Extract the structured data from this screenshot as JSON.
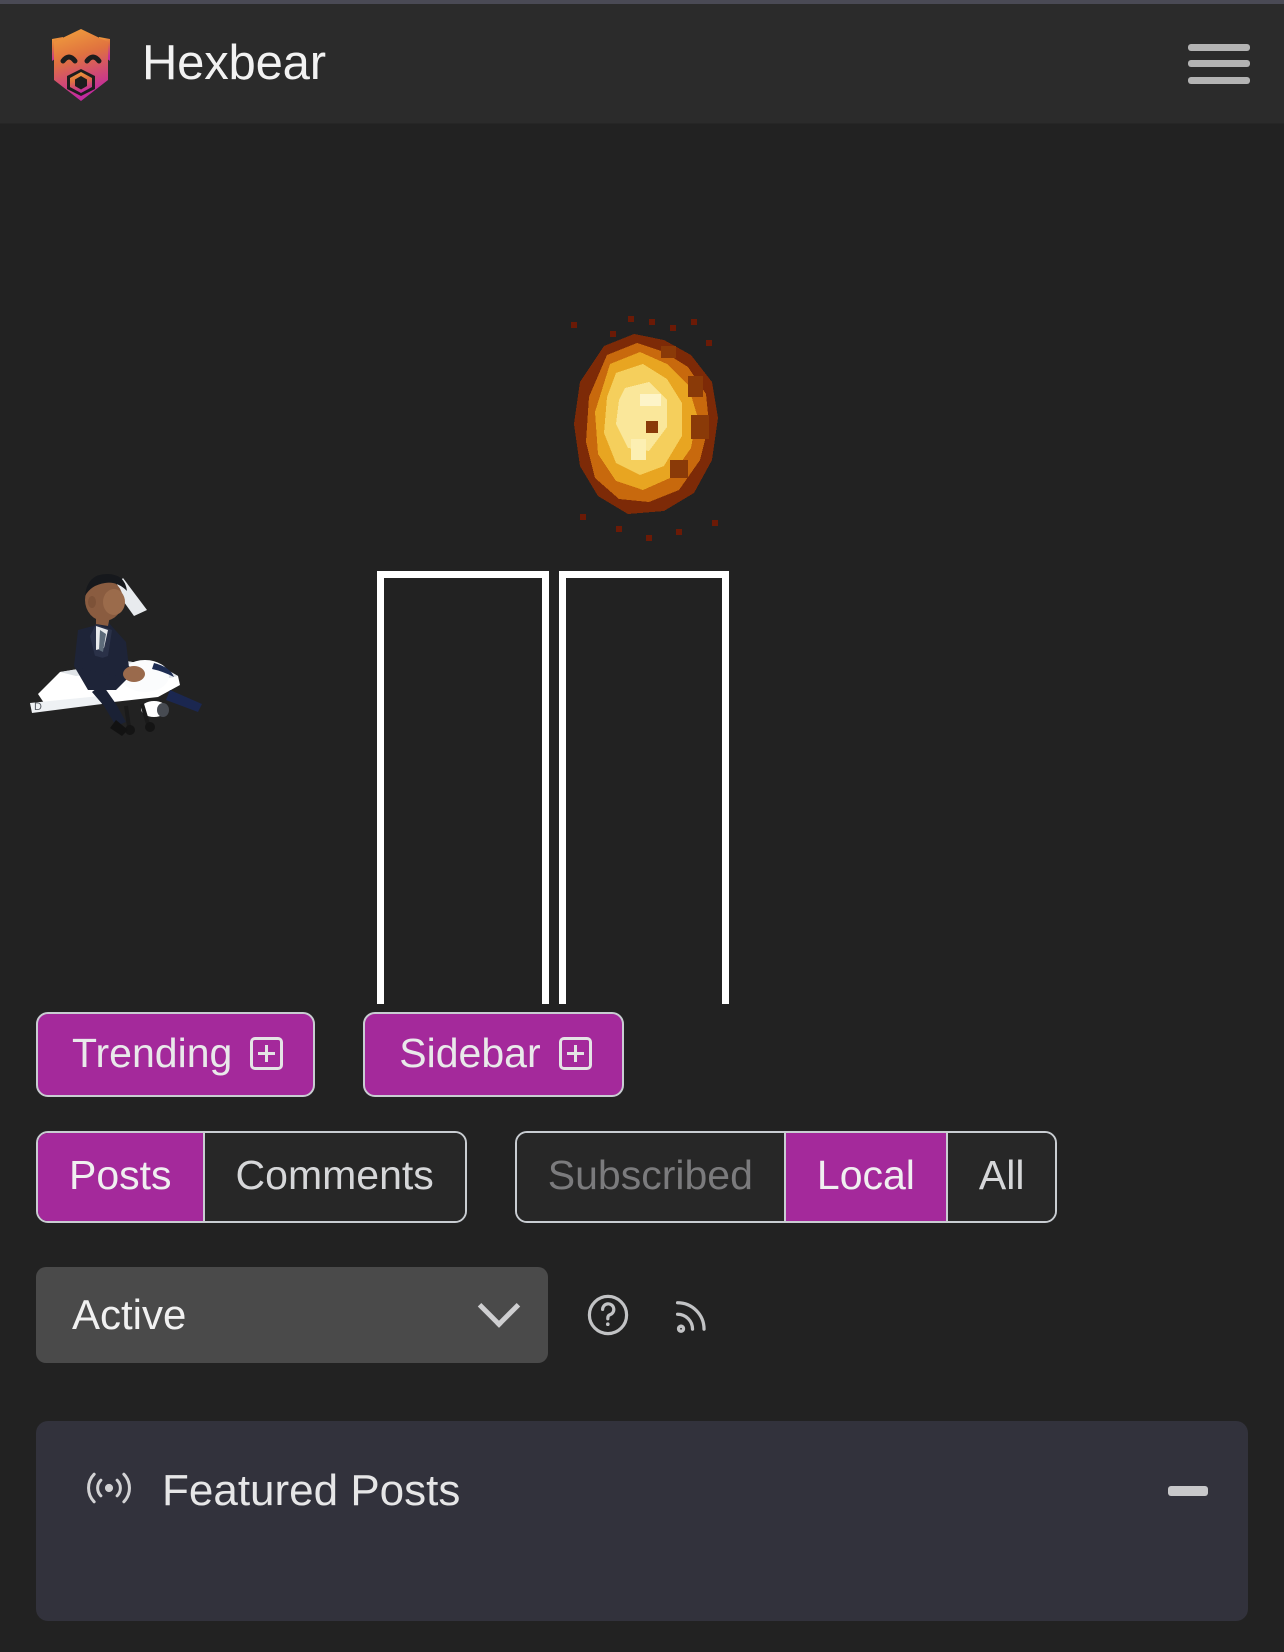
{
  "theme": {
    "background": "#222222",
    "navbar_bg": "#2b2b2b",
    "accent": "#a4299b",
    "card_bg": "#32323c",
    "text": "#e9e9ea",
    "muted_text": "#7b7b7d",
    "border": "#c9cdd2"
  },
  "navbar": {
    "logo_icon": "hexbear-hexagon-bear-logo",
    "brand": "Hexbear",
    "menu_icon": "hamburger-menu-icon"
  },
  "banner": {
    "explosion_icon": "pixel-explosion-sprite",
    "drone_icon": "obama-riding-predator-drone-image",
    "tower_left_label": "",
    "tower_right_label": ""
  },
  "actions": [
    {
      "label": "Trending",
      "icon": "plus-in-box-icon",
      "name": "trending-button"
    },
    {
      "label": "Sidebar",
      "icon": "plus-in-box-icon",
      "name": "sidebar-button"
    }
  ],
  "content_tabs": {
    "items": [
      {
        "label": "Posts",
        "active": true
      },
      {
        "label": "Comments",
        "active": false
      }
    ]
  },
  "listing_tabs": {
    "items": [
      {
        "label": "Subscribed",
        "active": false,
        "disabled": true
      },
      {
        "label": "Local",
        "active": true,
        "disabled": false
      },
      {
        "label": "All",
        "active": false,
        "disabled": false
      }
    ]
  },
  "sort": {
    "value": "Active",
    "chevron_icon": "chevron-down-icon",
    "help_icon": "question-circle-icon",
    "rss_icon": "rss-feed-icon"
  },
  "featured": {
    "icon": "broadcast-announcement-icon",
    "title": "Featured Posts",
    "collapse_icon": "minus-collapse-icon"
  }
}
